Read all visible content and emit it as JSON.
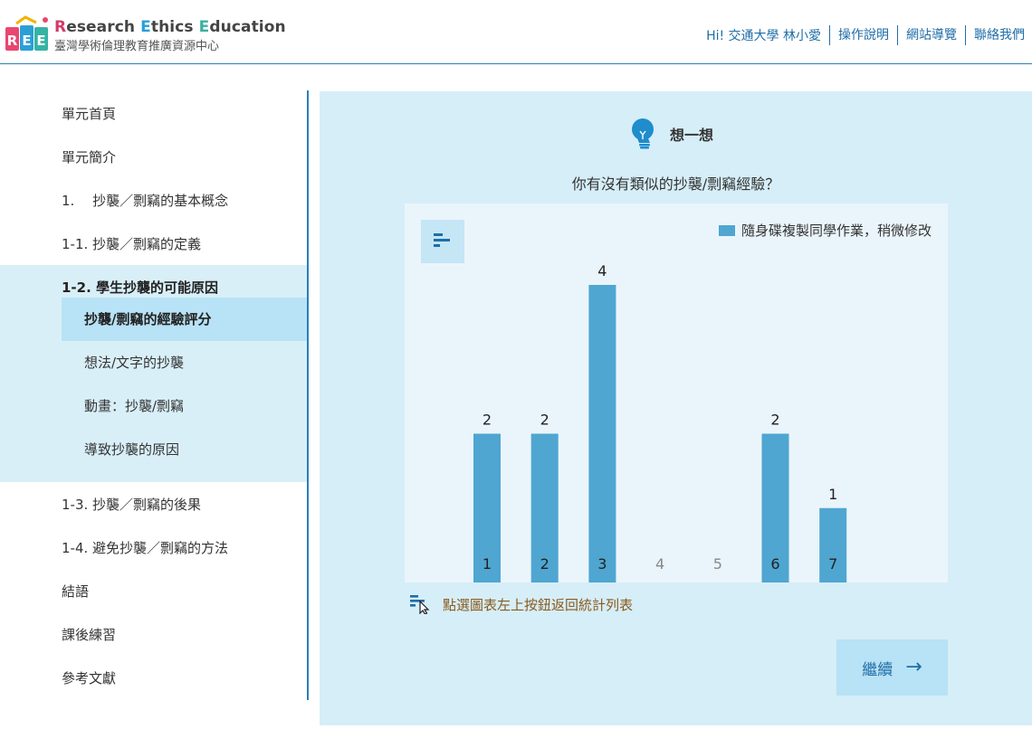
{
  "header": {
    "brand_r": "R",
    "brand_rest1": "esearch ",
    "brand_e1": "E",
    "brand_rest2": "thics ",
    "brand_e2": "E",
    "brand_rest3": "ducation",
    "subtitle": "臺灣學術倫理教育推廣資源中心",
    "greeting": "Hi! 交通大學 林小愛",
    "nav": [
      "操作說明",
      "網站導覽",
      "聯絡我們"
    ]
  },
  "sidebar": {
    "items_top": [
      "單元首頁",
      "單元簡介",
      "1.　 抄襲／剽竊的基本概念",
      "1-1. 抄襲／剽竊的定義"
    ],
    "group_title": "1-2. 學生抄襲的可能原因",
    "sub_items": [
      "抄襲/剽竊的經驗評分",
      "想法/文字的抄襲",
      "動畫：抄襲/剽竊",
      "導致抄襲的原因"
    ],
    "items_bottom": [
      "1-3. 抄襲／剽竊的後果",
      "1-4. 避免抄襲／剽竊的方法",
      "結語",
      "課後練習",
      "參考文獻"
    ]
  },
  "main": {
    "think_label": "想一想",
    "question": "你有沒有類似的抄襲/剽竊經驗？",
    "hint": "點選圖表左上按鈕返回統計列表",
    "continue_label": "繼續",
    "continue_arrow": "→"
  },
  "colors": {
    "bar": "#4fa6d1",
    "accent": "#1f6ea8",
    "panel": "#d6eef8"
  },
  "chart_data": {
    "type": "bar",
    "categories": [
      "1",
      "2",
      "3",
      "4",
      "5",
      "6",
      "7"
    ],
    "series": [
      {
        "name": "隨身碟複製同學作業，稍微修改",
        "values": [
          2,
          2,
          4,
          0,
          0,
          2,
          1
        ]
      }
    ],
    "data_labels": [
      "2",
      "2",
      "4",
      "",
      "",
      "2",
      "1"
    ],
    "ylim": [
      0,
      4
    ],
    "grid": false,
    "legend": "top-right"
  }
}
